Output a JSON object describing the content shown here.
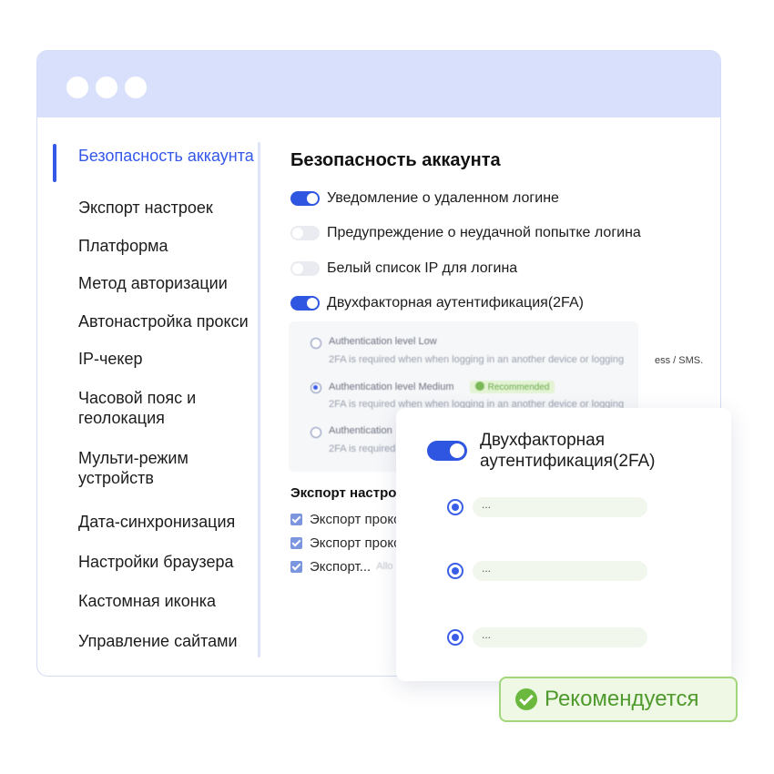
{
  "sidebar": {
    "items": [
      {
        "label": "Безопасность аккаунта",
        "active": true
      },
      {
        "label": "Экспорт настроек"
      },
      {
        "label": "Платформа"
      },
      {
        "label": "Метод авторизации"
      },
      {
        "label": "Автонастройка прокси"
      },
      {
        "label": "IP-чекер"
      },
      {
        "label": "Часовой пояс и геолокация"
      },
      {
        "label": "Мульти-режим устройств"
      },
      {
        "label": "Дата-синхронизация"
      },
      {
        "label": "Настройки браузера"
      },
      {
        "label": "Кастомная иконка"
      },
      {
        "label": "Управление сайтами"
      }
    ]
  },
  "main": {
    "title": "Безопасность аккаунта",
    "options": [
      {
        "label": "Уведомление о удаленном логине",
        "enabled": true
      },
      {
        "label": "Предупреждение о неудачной попытке логина",
        "enabled": false
      },
      {
        "label": "Белый список IP для логина",
        "enabled": false
      },
      {
        "label": "Двухфакторная аутентификация(2FA)",
        "enabled": true
      }
    ],
    "levels": [
      {
        "title": "Authentication level Low",
        "desc": "2FA is required when when logging in an another device or logging",
        "selected": false
      },
      {
        "title": "Authentication level Medium",
        "desc": "2FA is required when when logging in an another device or logging",
        "selected": true,
        "chip": "Recommended"
      },
      {
        "title": "Authentication",
        "desc": "2FA is required",
        "selected": false
      }
    ],
    "levels_overflow_text": "ess / SMS.",
    "export": {
      "title": "Экспорт настро",
      "items": [
        {
          "label": "Экспорт прокс"
        },
        {
          "label": "Экспорт прокс"
        },
        {
          "label": "Экспорт...",
          "faded": "Allo"
        }
      ]
    }
  },
  "popup": {
    "title": "Двухфакторная аутентификация(2FA)",
    "enabled": true,
    "options": [
      {
        "label": "...",
        "selected": true
      },
      {
        "label": "...",
        "selected": true
      },
      {
        "label": "...",
        "selected": true
      }
    ]
  },
  "badge": {
    "label": "Рекомендуется",
    "icon": "check-circle-icon"
  },
  "colors": {
    "accent": "#3558e8",
    "titlebar": "#d9e0fb",
    "recommended_green": "#6bb83f",
    "recommended_bg": "#eef8e5"
  }
}
